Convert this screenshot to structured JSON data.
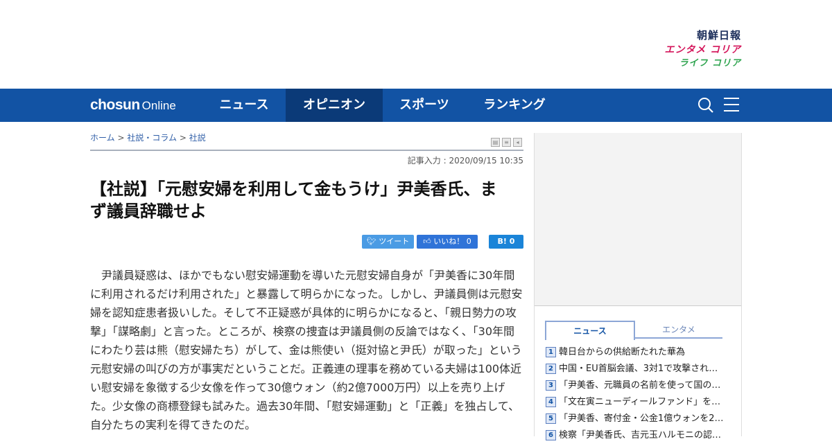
{
  "brands": {
    "chosun": "朝鮮日報",
    "entame": "エンタメ コリア",
    "life": "ライフ コリア"
  },
  "navbar": {
    "logo_main": "chosun",
    "logo_sub": "Online",
    "items": [
      "ニュース",
      "オピニオン",
      "スポーツ",
      "ランキング"
    ],
    "active_index": 1,
    "colors": {
      "bar": "#1253a4",
      "active": "#0b3a78"
    },
    "icons": [
      "search-icon",
      "menu-icon"
    ]
  },
  "breadcrumb": {
    "home": "ホーム",
    "sep": ">",
    "section": "社説・コラム",
    "sub": "社説"
  },
  "article": {
    "date": "記事入力 : 2020/09/15 10:35",
    "headline": "【社説】「元慰安婦を利用して金もうけ」尹美香氏、まず議員辞職せよ",
    "share": {
      "tweet": "ツイート",
      "like": "いいね！ 0",
      "hatena": "B! 0"
    },
    "body": "尹議員疑惑は、ほかでもない慰安婦運動を導いた元慰安婦自身が「尹美香に30年間に利用されるだけ利用された」と暴露して明らかになった。しかし、尹議員側は元慰安婦を認知症患者扱いした。そして不正疑惑が具体的に明らかになると、「親日勢力の攻撃」「謀略劇」と言った。ところが、検察の捜査は尹議員側の反論ではなく、「30年間にわたり芸は熊（慰安婦たち）がして、金は熊使い（挺対協と尹氏）が取った」という元慰安婦の叫びの方が事実だということだ。正義連の理事を務めている夫婦は100体近い慰安婦を象徴する少女像を作って30億ウォン（約2億7000万円）以上を売り上げた。少女像の商標登録も試みた。過去30年間、「慰安婦運動」と「正義」を独占して、自分たちの実利を得てきたのだ。"
  },
  "sidebar": {
    "tabs": [
      "ニュース",
      "エンタメ"
    ],
    "ranking": [
      {
        "num": "1",
        "title": "韓日台からの供給断たれた華為"
      },
      {
        "num": "2",
        "title": "中国・EU首脳会議、3対1で攻撃され…"
      },
      {
        "num": "3",
        "title": "「尹美香、元職員の名前を使って国の…"
      },
      {
        "num": "4",
        "title": "「文在寅ニューディールファンド」を…"
      },
      {
        "num": "5",
        "title": "「尹美香、寄付金・公金1億ウォンを2…"
      },
      {
        "num": "6",
        "title": "検察「尹美香氏、吉元玉ハルモニの認…"
      }
    ]
  }
}
